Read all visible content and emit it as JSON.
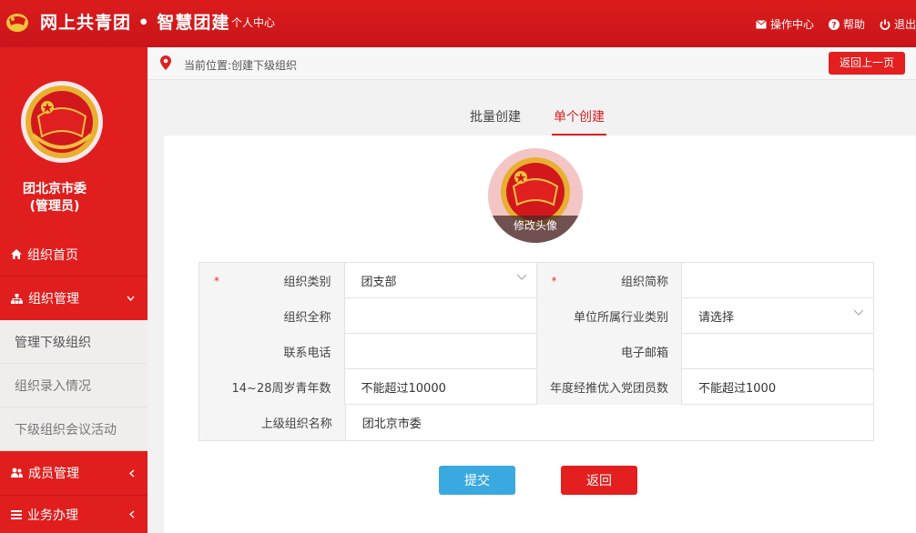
{
  "header": {
    "brand": "网上共青团 • 智慧团建",
    "personal_center": "个人中心",
    "ops_center": "操作中心",
    "help": "帮助",
    "logout": "退出"
  },
  "sidebar": {
    "org_name_line1": "团北京市委",
    "org_name_line2": "(管理员)",
    "items": [
      {
        "label": "组织首页",
        "icon": "home-icon"
      },
      {
        "label": "组织管理",
        "icon": "org-tree-icon"
      },
      {
        "label": "成员管理",
        "icon": "members-icon"
      },
      {
        "label": "业务办理",
        "icon": "list-icon"
      }
    ],
    "sub_items": [
      {
        "label": "管理下级组织"
      },
      {
        "label": "组织录入情况"
      },
      {
        "label": "下级组织会议活动"
      }
    ]
  },
  "breadcrumb": {
    "text": "当前位置:创建下级组织",
    "back_label": "返回上一页"
  },
  "tabs": {
    "batch": "批量创建",
    "single": "单个创建"
  },
  "avatar": {
    "edit_label": "修改头像"
  },
  "form": {
    "rows": [
      {
        "l1": "组织类别",
        "v1": "团支部",
        "l2": "组织简称",
        "v2": ""
      },
      {
        "l1": "组织全称",
        "v1": "",
        "l2": "单位所属行业类别",
        "v2": "请选择"
      },
      {
        "l1": "联系电话",
        "v1": "",
        "l2": "电子邮箱",
        "v2": ""
      },
      {
        "l1": "14~28周岁青年数",
        "v1": "不能超过10000",
        "l2": "年度经推优入党团员数",
        "v2": "不能超过1000"
      },
      {
        "l1": "上级组织名称",
        "v1": "团北京市委"
      }
    ],
    "required_mark": "*"
  },
  "buttons": {
    "submit": "提交",
    "back": "返回"
  },
  "colors": {
    "primary_red": "#e01e1e",
    "submit_blue": "#3aa9e0"
  }
}
